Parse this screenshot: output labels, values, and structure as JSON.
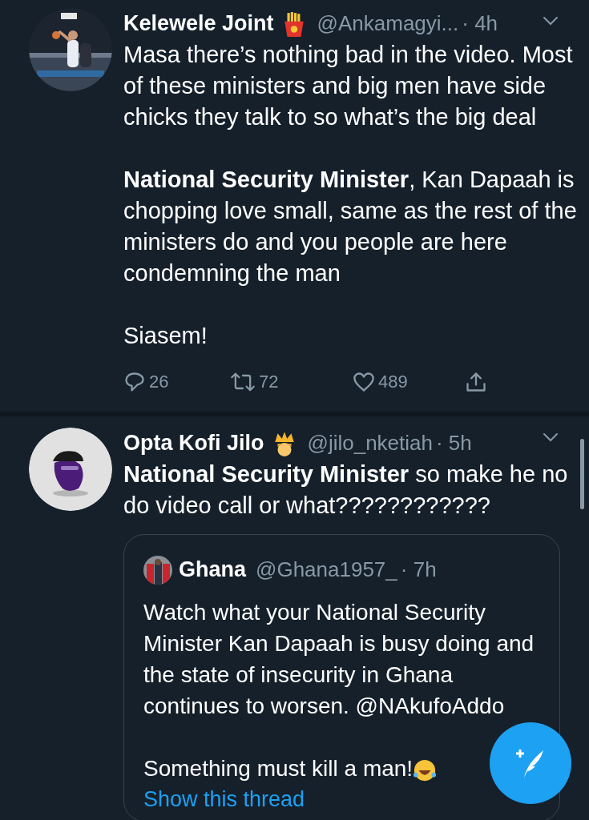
{
  "tweets": [
    {
      "name": "Kelewele Joint",
      "name_badge": {
        "kind": "fries"
      },
      "handle": "@Ankamagyi...",
      "time": "· 4h",
      "body": [
        "Masa there’s nothing bad in the video. Most of these ministers and big men have side chicks they talk to so what’s the big deal",
        "**National Security Minister**, Kan Dapaah is chopping love small, same as the rest of the ministers do and you people are here condemning the man",
        "Siasem!"
      ],
      "actions": {
        "replies": "26",
        "retweets": "72",
        "likes": "489"
      }
    },
    {
      "name": "Opta Kofi Jilo",
      "name_badge": {
        "kind": "crown"
      },
      "handle": "@jilo_nketiah",
      "time": "· 5h",
      "avatar": {
        "kind": "logo"
      },
      "body": [
        "**National Security Minister** so make he no do video call or what????????????"
      ],
      "quote": {
        "name": "Ghana",
        "handle": "@Ghana1957_",
        "time": "· 7h",
        "body": [
          "Watch what your National Security Minister Kan Dapaah is busy doing and the state of insecurity in Ghana continues to worsen. @NAkufoAddo",
          "Something must kill a man!"
        ],
        "body_end_badge": {
          "kind": "laughing"
        },
        "link": "Show this thread"
      }
    }
  ]
}
